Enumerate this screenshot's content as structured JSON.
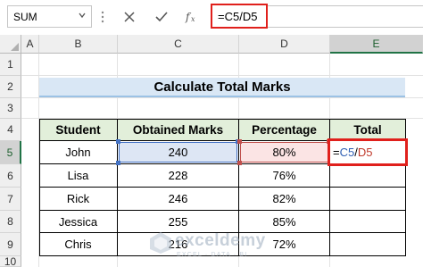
{
  "formula_bar": {
    "name_box": "SUM",
    "cancel_icon": "close-icon",
    "enter_icon": "checkmark-icon",
    "function_icon": "fx-icon",
    "formula": "=C5/D5"
  },
  "sheet": {
    "columns": [
      "A",
      "B",
      "C",
      "D",
      "E"
    ],
    "rows": [
      "1",
      "2",
      "3",
      "4",
      "5",
      "6",
      "7",
      "8",
      "9",
      "10"
    ],
    "active_column": "E",
    "active_row": "5",
    "title": "Calculate Total Marks"
  },
  "table": {
    "headers": [
      "Student",
      "Obtained Marks",
      "Percentage",
      "Total"
    ],
    "rows": [
      [
        "John",
        "240",
        "80%",
        ""
      ],
      [
        "Lisa",
        "228",
        "76%",
        ""
      ],
      [
        "Rick",
        "246",
        "82%",
        ""
      ],
      [
        "Jessica",
        "255",
        "85%",
        ""
      ],
      [
        "Chris",
        "216",
        "72%",
        ""
      ]
    ],
    "editing_cell": {
      "eq": "=",
      "ref1": "C5",
      "slash": "/",
      "ref2": "D5"
    }
  },
  "colors": {
    "header_fill": "#e2efda",
    "title_fill": "#d9e7f5",
    "highlight_red": "#e0201c",
    "ref_blue": "#4472c4",
    "ref_red": "#c0504d"
  },
  "watermark": {
    "name": "exceldemy",
    "subtitle": "EXCEL · DATA · BI"
  }
}
